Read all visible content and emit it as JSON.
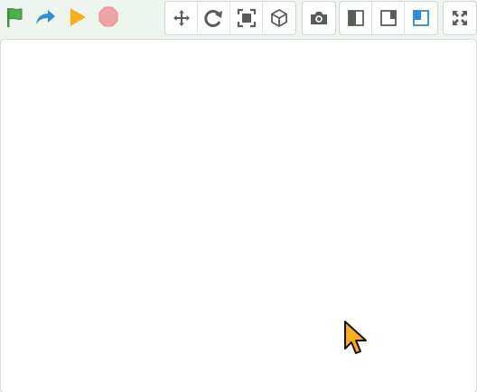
{
  "colors": {
    "flag": "#4cae4c",
    "turbo": "#2f8fd8",
    "play": "#fbb019",
    "stop": "#f0a3a3",
    "icon": "#575e57",
    "active": "#2b89e0",
    "cursor": "#fbb019"
  },
  "run_controls": [
    {
      "icon": "green-flag-icon"
    },
    {
      "icon": "turbo-forward-icon"
    },
    {
      "icon": "play-icon"
    },
    {
      "icon": "stop-icon"
    }
  ],
  "tool_groups": [
    {
      "icon": "move-icon"
    },
    {
      "icon": "rotate-icon"
    },
    {
      "icon": "fit-frame-icon"
    },
    {
      "icon": "3d-cube-icon"
    },
    {
      "icon": "camera-icon"
    },
    {
      "icon": "layout-split-icon"
    },
    {
      "icon": "layout-small-stage-icon"
    },
    {
      "icon": "layout-large-stage-icon",
      "active": true
    },
    {
      "icon": "fullscreen-icon"
    }
  ]
}
